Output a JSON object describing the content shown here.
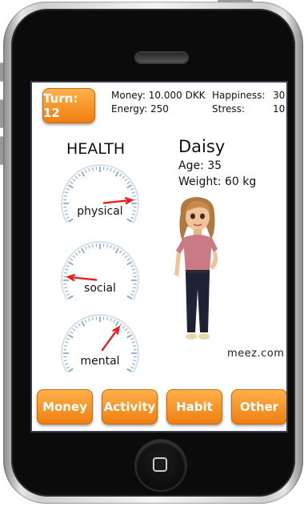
{
  "turn_button": "Turn: 12",
  "stats": {
    "money": "Money: 10.000 DKK",
    "happiness_label": "Happiness:",
    "happiness_value": "30",
    "energy": "Energy: 250",
    "stress_label": "Stress:",
    "stress_value": "10"
  },
  "health": {
    "title": "HEALTH",
    "gauges": [
      {
        "label": "physical",
        "value": 0.85
      },
      {
        "label": "social",
        "value": 0.15
      },
      {
        "label": "mental",
        "value": 0.65
      }
    ]
  },
  "character": {
    "name": "Daisy",
    "age": "Age: 35",
    "weight": "Weight: 60 kg",
    "credit": "meez.com"
  },
  "actions": [
    "Money",
    "Activity",
    "Habit",
    "Other"
  ],
  "colors": {
    "accent": "#f08a1c",
    "needle": "#e8201e",
    "gauge_tick": "#7aa3c8"
  }
}
